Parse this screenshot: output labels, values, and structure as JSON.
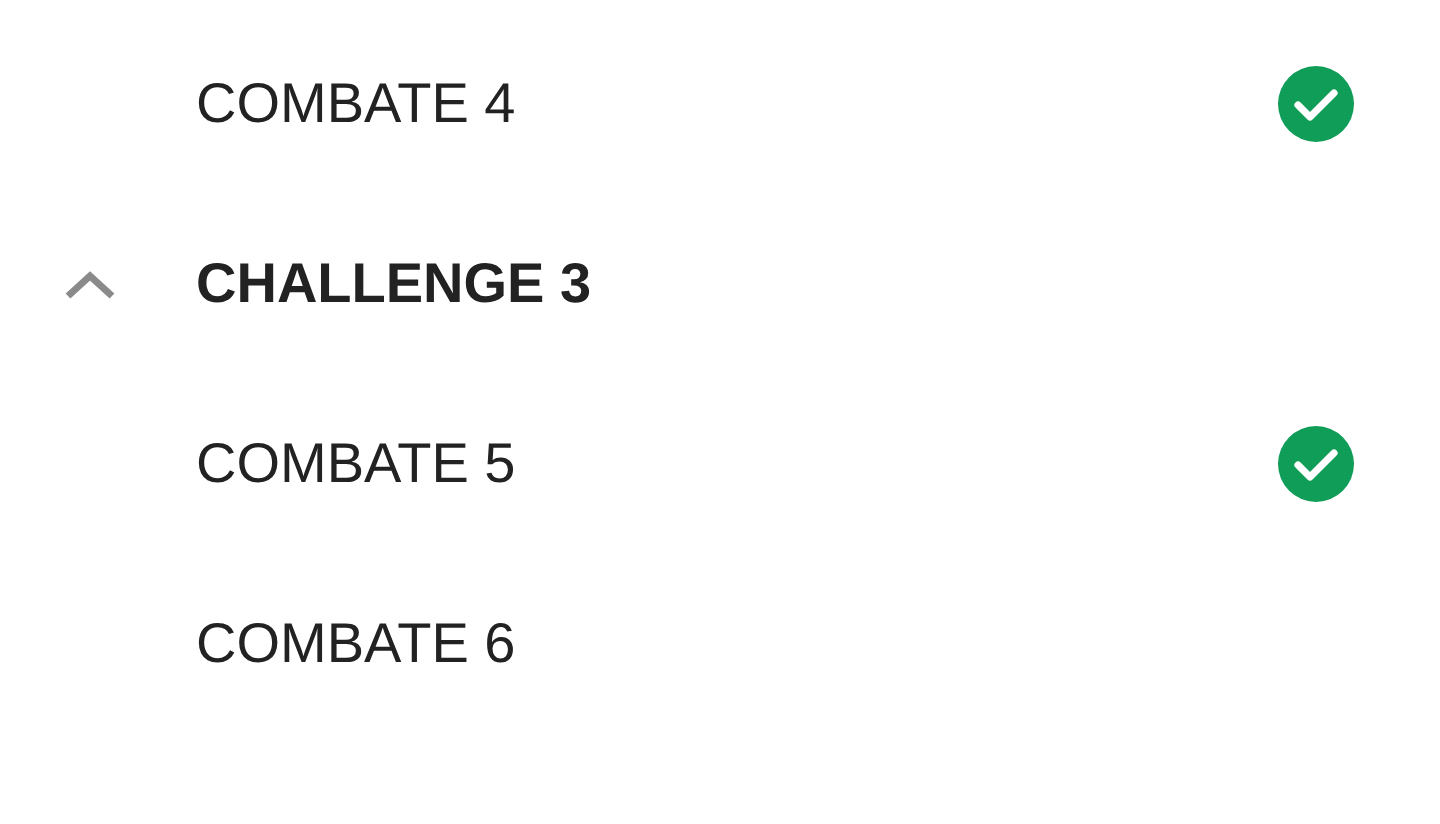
{
  "items": [
    {
      "kind": "combat",
      "label": "COMBATE 4",
      "completed": true
    },
    {
      "kind": "group",
      "label": "CHALLENGE 3",
      "expanded": true,
      "children": [
        {
          "kind": "combat",
          "label": "COMBATE 5",
          "completed": true
        },
        {
          "kind": "combat",
          "label": "COMBATE 6",
          "completed": false
        }
      ]
    }
  ]
}
